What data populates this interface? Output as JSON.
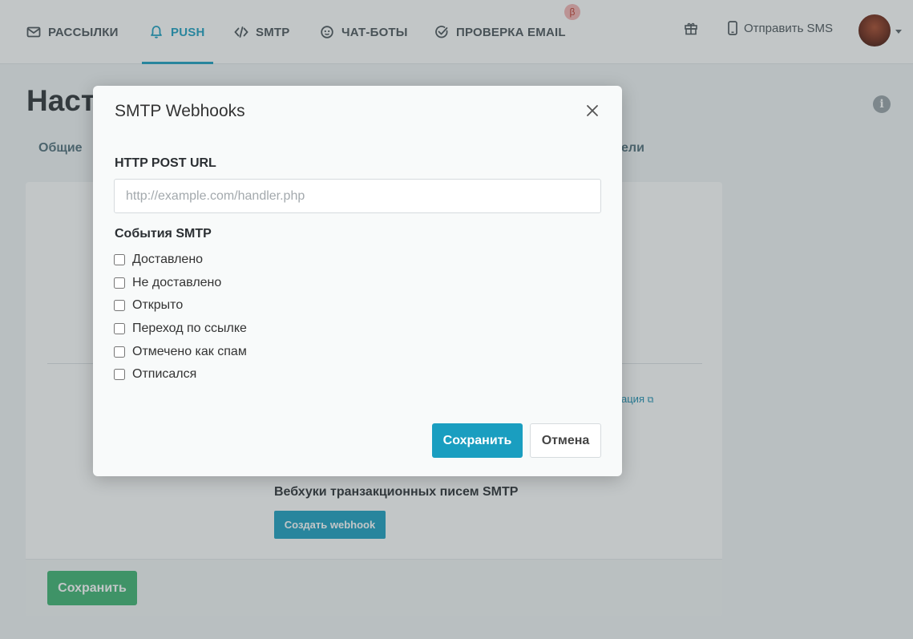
{
  "nav": {
    "items": [
      {
        "label": "РАССЫЛКИ",
        "icon": "envelope-icon"
      },
      {
        "label": "PUSH",
        "icon": "bell-icon",
        "active": true
      },
      {
        "label": "SMTP",
        "icon": "code-icon"
      },
      {
        "label": "ЧАТ-БОТЫ",
        "icon": "chat-bot-icon"
      },
      {
        "label": "ПРОВЕРКА EMAIL",
        "icon": "check-circle-icon"
      }
    ],
    "beta_badge": "β",
    "gift_icon": "gift-icon",
    "sms_label": "Отправить SMS",
    "sms_icon": "phone-icon"
  },
  "page": {
    "title": "Настр",
    "tab_general": "Общие",
    "tab_right_fragment": "ели",
    "link_fragment": "ация",
    "webhook_heading": "Вебхуки транзакционных писем SMTP",
    "create_webhook": "Создать webhook",
    "save": "Сохранить"
  },
  "modal": {
    "title": "SMTP Webhooks",
    "url_label": "HTTP POST URL",
    "url_value": "",
    "url_placeholder": "http://example.com/handler.php",
    "events_label": "События SMTP",
    "events": [
      {
        "label": "Доставлено",
        "checked": false
      },
      {
        "label": "Не доставлено",
        "checked": false
      },
      {
        "label": "Открыто",
        "checked": false
      },
      {
        "label": "Переход по ссылке",
        "checked": false
      },
      {
        "label": "Отмечено как спам",
        "checked": false
      },
      {
        "label": "Отписался",
        "checked": false
      }
    ],
    "save": "Сохранить",
    "cancel": "Отмена"
  },
  "colors": {
    "accent": "#1a9ec0",
    "save_green": "#3cb371",
    "beta_bg": "#f5b4b4"
  }
}
